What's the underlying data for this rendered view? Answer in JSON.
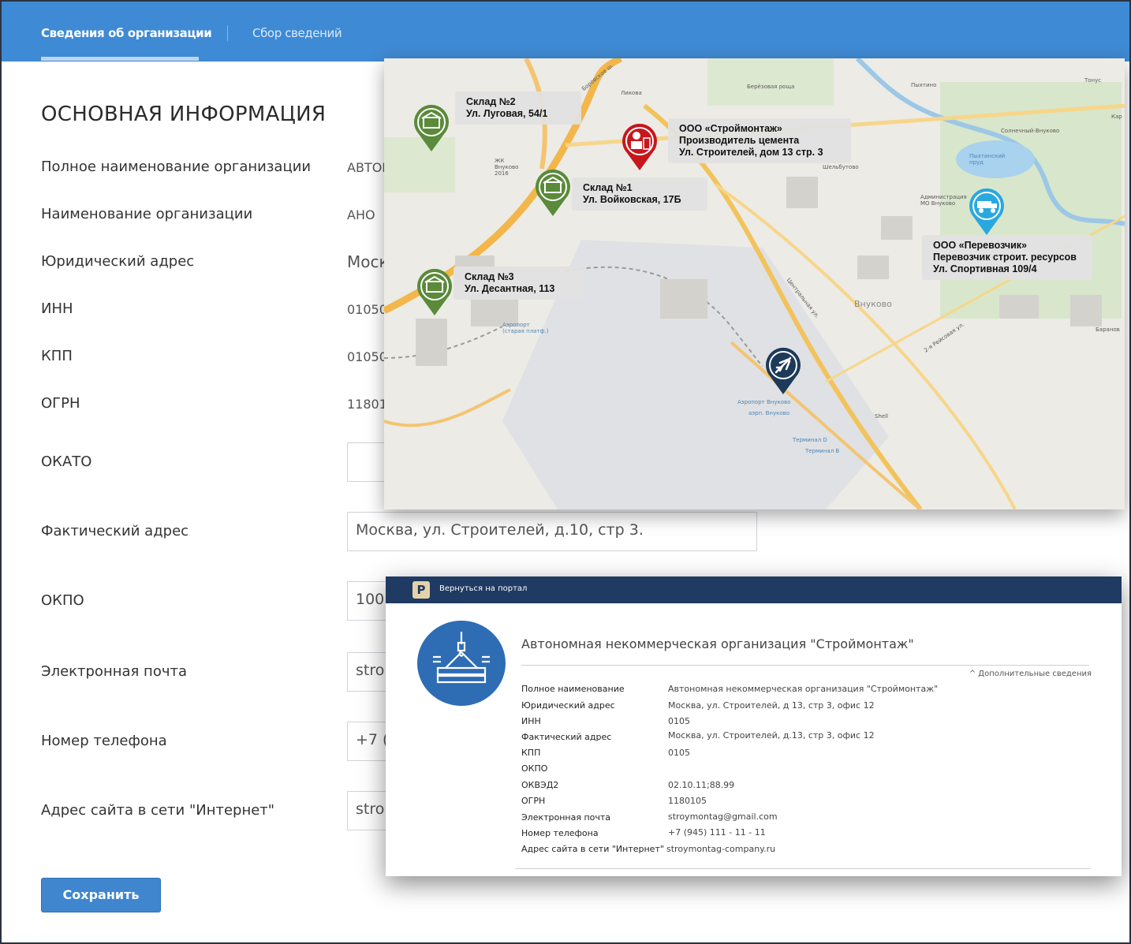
{
  "tabs": {
    "active": "Сведения об организации",
    "inactive": "Сбор сведений"
  },
  "section_title": "ОСНОВНАЯ ИНФОРМАЦИЯ",
  "fields": {
    "full_name": {
      "label": "Полное наименование организации",
      "value": "АВТОІ"
    },
    "short_name": {
      "label": "Наименование организации",
      "value": "АНО"
    },
    "legal_addr": {
      "label": "Юридический адрес",
      "value": "Моск"
    },
    "inn": {
      "label": "ИНН",
      "value": "01050"
    },
    "kpp": {
      "label": "КПП",
      "value": "01050"
    },
    "ogrn": {
      "label": "ОГРН",
      "value": "11801"
    },
    "okato": {
      "label": "ОКАТО",
      "value": ""
    },
    "actual_addr": {
      "label": "Фактический адрес",
      "value": "Москва, ул. Строителей, д.10, стр 3."
    },
    "okpo": {
      "label": "ОКПО",
      "value": "100"
    },
    "email": {
      "label": "Электронная почта",
      "value": "stro"
    },
    "phone": {
      "label": "Номер телефона",
      "value": "+7 ("
    },
    "site": {
      "label": "Адрес сайта в сети \"Интернет\"",
      "value": "stro"
    }
  },
  "save_label": "Сохранить",
  "map": {
    "callouts": {
      "warehouse2": {
        "line1": "Склад №2",
        "line2": "Ул. Луговая, 54/1"
      },
      "stroymontag": {
        "line1": "ООО «Строймонтаж»",
        "line2": "Производитель цемента",
        "line3": "Ул. Строителей, дом 13 стр. 3"
      },
      "warehouse1": {
        "line1": "Склад №1",
        "line2": "Ул. Войковская, 17Б"
      },
      "carrier": {
        "line1": "ООО «Перевозчик»",
        "line2": "Перевозчик строит. ресурсов",
        "line3": "Ул. Спортивная 109/4"
      },
      "warehouse3": {
        "line1": "Склад №3",
        "line2": "Ул. Десантная, 113"
      }
    },
    "place_labels": {
      "likova": "Ликова",
      "berezovaya": "Берёзовая роща",
      "pykhtino": "Пыхтино",
      "tonus": "Тонус",
      "kar": "Кар",
      "solnechny": "Солнечный-Внуково",
      "pykhtinsky": "Пыхтинский пруд",
      "shelbutovo": "Шельбутово",
      "admin": "Администрация МО Внуково",
      "vnukovo": "Внуково",
      "baranovo": "Баранов",
      "aeroport_old": "Аэропорт (старая платф.)",
      "airport": "Аэропорт Внуково",
      "airport2": "аэрп. Внуково",
      "terminal_d": "Терминал D",
      "terminal_v": "Терминал В",
      "shell": "Shell",
      "zhk": "ЖК Внуково 2016",
      "borovskoe": "Боровское ш.",
      "tsentralnaya": "Центральная ул.",
      "rejsovaya": "2-я Рейсовая ул."
    },
    "colors": {
      "warehouse": "#5a8a3a",
      "producer": "#c8161d",
      "carrier": "#29a8e0",
      "airport": "#1d3a5a"
    }
  },
  "card": {
    "back_label": "Вернуться на портал",
    "logo_letter": "Р",
    "title": "Автономная некоммерческая организация \"Строймонтаж\"",
    "more_label": "^ Дополнительные сведения",
    "rows": {
      "r1": {
        "label": "Полное наименование",
        "value": "Автономная некоммерческая организация \"Строймонтаж\""
      },
      "r2": {
        "label": "Юридический адрес",
        "value": "Москва, ул. Строителей, д 13, стр 3, офис 12"
      },
      "r3": {
        "label": "ИНН",
        "value": "0105"
      },
      "r4": {
        "label": "Фактический адрес",
        "value": "Москва, ул. Строителей, д.13, стр 3, офис 12"
      },
      "r5": {
        "label": "КПП",
        "value": "0105"
      },
      "r6": {
        "label": "ОКПО",
        "value": ""
      },
      "r7": {
        "label": "ОКВЭД2",
        "value": "02.10.11;88.99"
      },
      "r8": {
        "label": "ОГРН",
        "value": "1180105"
      },
      "r9": {
        "label": "Электронная почта",
        "value": "stroymontag@gmail.com"
      },
      "r10": {
        "label": "Номер телефона",
        "value": "+7 (945) 111 - 11 - 11"
      },
      "r11": {
        "label": "Адрес сайта в сети \"Интернет\"",
        "value": "stroymontag-company.ru"
      }
    }
  }
}
